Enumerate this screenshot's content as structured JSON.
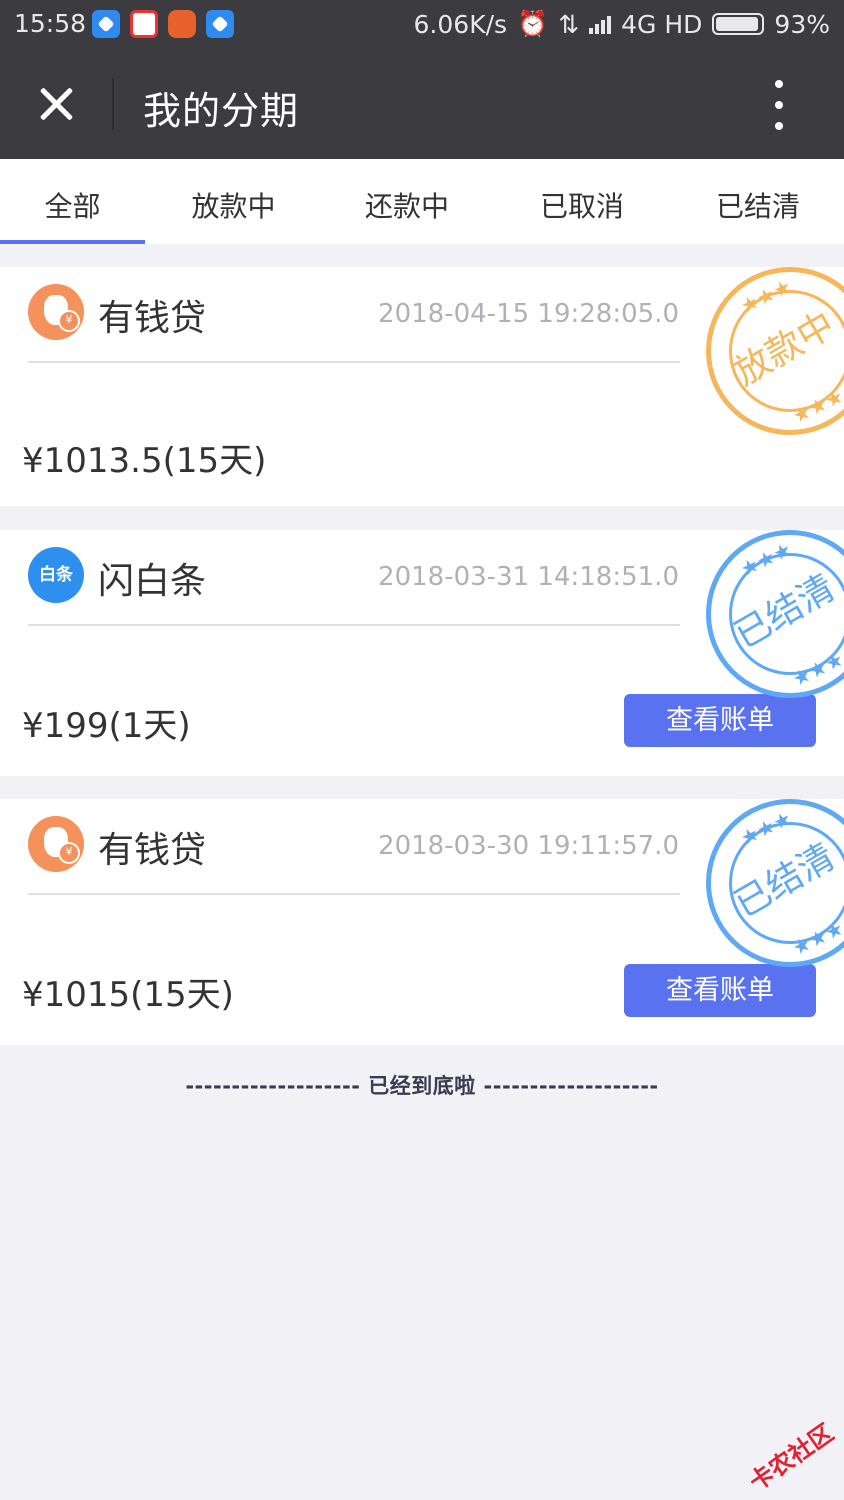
{
  "status_bar": {
    "time": "15:58",
    "net_speed": "6.06K/s",
    "network": "4G HD",
    "battery": "93%",
    "icons": [
      "alarm-icon",
      "data-arrows-icon",
      "signal-icon",
      "battery-icon"
    ]
  },
  "header": {
    "title": "我的分期",
    "close_icon": "close-icon",
    "more_icon": "more-vertical-icon"
  },
  "tabs": [
    {
      "label": "全部",
      "active": true
    },
    {
      "label": "放款中",
      "active": false
    },
    {
      "label": "还款中",
      "active": false
    },
    {
      "label": "已取消",
      "active": false
    },
    {
      "label": "已结清",
      "active": false
    }
  ],
  "orders": [
    {
      "name": "有钱贷",
      "time": "2018-04-15 19:28:05.0",
      "amount": "¥1013.5(15天)",
      "status": "放款中",
      "status_color": "#f6b65a",
      "logo": "money-bag-icon",
      "button": ""
    },
    {
      "name": "闪白条",
      "time": "2018-03-31 14:18:51.0",
      "amount": "¥199(1天)",
      "status": "已结清",
      "status_color": "#5fa8f5",
      "logo": "baitiao-logo-icon",
      "logo_text": "白条",
      "button": "查看账单"
    },
    {
      "name": "有钱贷",
      "time": "2018-03-30 19:11:57.0",
      "amount": "¥1015(15天)",
      "status": "已结清",
      "status_color": "#5fa8f5",
      "logo": "money-bag-icon",
      "button": "查看账单"
    }
  ],
  "footer": {
    "end_text": "------------------- 已经到底啦 -------------------"
  },
  "watermark": "卡农社区",
  "colors": {
    "header_bg": "#3b3b40",
    "accent": "#5b72f0",
    "page_bg": "#f2f2f6"
  }
}
